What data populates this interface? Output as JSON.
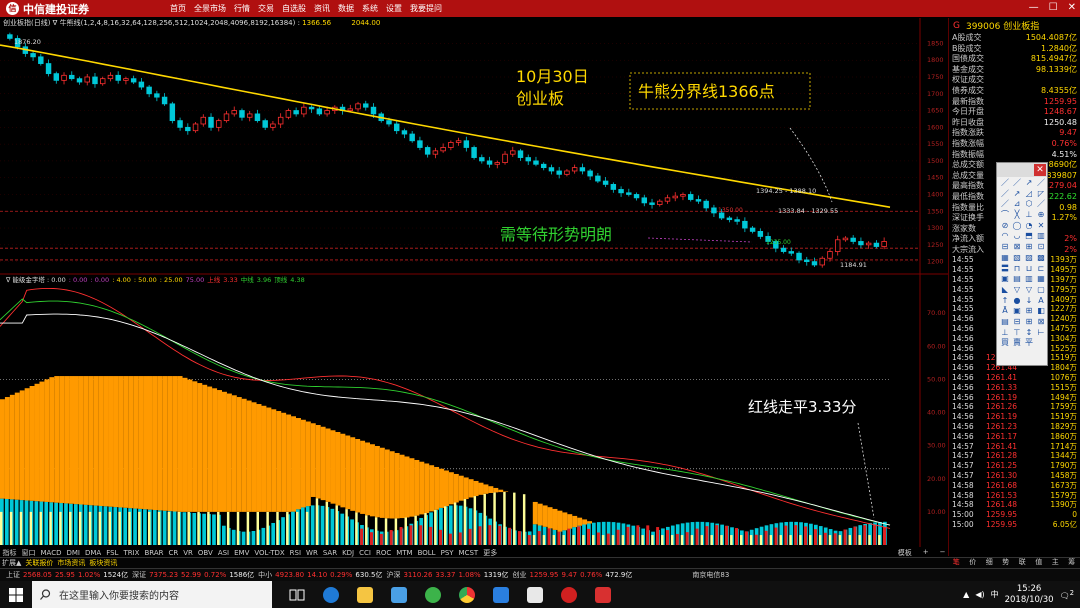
{
  "app": {
    "brand": "中信建投证券",
    "brand_badge": "信",
    "menu": [
      "首页",
      "全景市场",
      "行情",
      "交易",
      "自选股",
      "资讯",
      "数据",
      "系统",
      "设置",
      "我要提问"
    ],
    "window_controls": [
      "—",
      "☐",
      "✕"
    ]
  },
  "chart_header": {
    "prefix": "创业板指(日线) ∇ 牛熊线(1,2,4,8,16,32,64,128,256,512,1024,2048,4096,8192,16384) :",
    "ma_value": "1366.56",
    "extra": "2044.00"
  },
  "price_axis_labels": [
    "1850",
    "1800",
    "1750",
    "1700",
    "1650",
    "1600",
    "1550",
    "1500",
    "1450",
    "1400",
    "1350",
    "1300",
    "1250",
    "1200"
  ],
  "osc_axis_labels": [
    "70.00",
    "60.00",
    "50.00",
    "40.00",
    "30.00",
    "20.00",
    "10.00"
  ],
  "date_labels": [
    "2018/08",
    "9",
    "10"
  ],
  "annotations": {
    "date_title_1": "10月30日",
    "date_title_2": "创业板",
    "boundary_box": "牛熊分界线1366点",
    "wait_text": "需等待形势明朗",
    "red_line_text": "红线走平3.33分",
    "hi_label": "1876.20",
    "range_label_1": "1394.25 - 1388.10",
    "range_label_2": "1333.84 - 1329.55",
    "low_label": "1184.91",
    "mid_label_1": "1350.00",
    "mid_label_2": "1235.00"
  },
  "osc_header": {
    "name": "∇ 能级金字塔 : 0.00",
    "items": [
      ": 0.00",
      ": 0.00",
      ": 4.00",
      ": 50.00",
      ": 25.00"
    ],
    "v75": "75.00",
    "upper_label": "上线",
    "upper": "3.33",
    "mid_label": "中线",
    "mid": "3.96",
    "lower_label": "顶线",
    "lower": "4.38"
  },
  "right_panel": {
    "header_g": "G",
    "code": "399006 创业板指",
    "stats": [
      {
        "label": "A股成交",
        "value": "1504.4087亿",
        "color": "yellow"
      },
      {
        "label": "B股成交",
        "value": "1.2840亿",
        "color": "yellow"
      },
      {
        "label": "国债成交",
        "value": "815.4947亿",
        "color": "yellow"
      },
      {
        "label": "基金成交",
        "value": "98.1339亿",
        "color": "yellow"
      },
      {
        "label": "权证成交",
        "value": "",
        "color": "yellow"
      },
      {
        "label": "债券成交",
        "value": "8.4355亿",
        "color": "yellow"
      },
      {
        "label": "最新指数",
        "value": "1259.95",
        "color": "red"
      },
      {
        "label": "今日开盘",
        "value": "1248.67",
        "color": "red"
      },
      {
        "label": "昨日收盘",
        "value": "1250.48",
        "color": "white"
      },
      {
        "label": "指数涨跌",
        "value": "9.47",
        "color": "red"
      },
      {
        "label": "指数涨幅",
        "value": "0.76%",
        "color": "red"
      },
      {
        "label": "指数振幅",
        "value": "4.51%",
        "color": "white"
      },
      {
        "label": "总成交额",
        "value": "8690亿",
        "color": "yellow"
      },
      {
        "label": "总成交量",
        "value": "339807",
        "color": "yellow"
      },
      {
        "label": "最高指数",
        "value": "1279.04",
        "color": "red"
      },
      {
        "label": "最低指数",
        "value": "1222.62",
        "color": "green"
      },
      {
        "label": "指数量比",
        "value": "0.98",
        "color": "yellow"
      },
      {
        "label": "深证换手",
        "value": "1.27%",
        "color": "yellow"
      },
      {
        "label": "涨家数",
        "value": "",
        "color": "red"
      },
      {
        "label": "净流入额",
        "value": "2%",
        "color": "red"
      },
      {
        "label": "大宗流入",
        "value": "2%",
        "color": "red"
      }
    ],
    "ticks": [
      {
        "t": "14:55",
        "p": "",
        "v": "1393万"
      },
      {
        "t": "14:55",
        "p": "",
        "v": "1495万"
      },
      {
        "t": "14:55",
        "p": "",
        "v": "1397万"
      },
      {
        "t": "14:55",
        "p": "",
        "v": "1795万"
      },
      {
        "t": "14:55",
        "p": "",
        "v": "1409万"
      },
      {
        "t": "14:55",
        "p": "",
        "v": "1227万"
      },
      {
        "t": "14:56",
        "p": "",
        "v": "1240万"
      },
      {
        "t": "14:56",
        "p": "",
        "v": "1475万"
      },
      {
        "t": "14:56",
        "p": "",
        "v": "1304万"
      },
      {
        "t": "14:56",
        "p": "",
        "v": "1525万"
      },
      {
        "t": "14:56",
        "p": "1261.29",
        "v": "1519万"
      },
      {
        "t": "14:56",
        "p": "1261.44",
        "v": "1804万"
      },
      {
        "t": "14:56",
        "p": "1261.41",
        "v": "1076万"
      },
      {
        "t": "14:56",
        "p": "1261.33",
        "v": "1515万"
      },
      {
        "t": "14:56",
        "p": "1261.19",
        "v": "1494万"
      },
      {
        "t": "14:56",
        "p": "1261.26",
        "v": "1759万"
      },
      {
        "t": "14:56",
        "p": "1261.19",
        "v": "1519万"
      },
      {
        "t": "14:56",
        "p": "1261.23",
        "v": "1829万"
      },
      {
        "t": "14:56",
        "p": "1261.17",
        "v": "1860万"
      },
      {
        "t": "14:57",
        "p": "1261.41",
        "v": "1714万"
      },
      {
        "t": "14:57",
        "p": "1261.28",
        "v": "1344万"
      },
      {
        "t": "14:57",
        "p": "1261.25",
        "v": "1790万"
      },
      {
        "t": "14:57",
        "p": "1261.30",
        "v": "1458万"
      },
      {
        "t": "14:58",
        "p": "1261.68",
        "v": "1673万"
      },
      {
        "t": "14:58",
        "p": "1261.53",
        "v": "1579万"
      },
      {
        "t": "14:58",
        "p": "1261.48",
        "v": "1390万"
      },
      {
        "t": "15:00",
        "p": "1259.95",
        "v": "0"
      },
      {
        "t": "15:00",
        "p": "1259.95",
        "v": "6.05亿"
      }
    ]
  },
  "draw_tools": [
    "／",
    "／",
    "↗",
    "／",
    "／",
    "↗",
    "◿",
    "◸",
    "／",
    "⊿",
    "⬡",
    "／",
    "⌒",
    "╳",
    "⊥",
    "⊕",
    "⊘",
    "◯",
    "◔",
    "✕",
    "◠",
    "◡",
    "⬒",
    "▥",
    "⊟",
    "⊠",
    "⊞",
    "⊡",
    "▦",
    "▧",
    "▨",
    "▩",
    "〓",
    "⊓",
    "⊔",
    "⊏",
    "▣",
    "▤",
    "▥",
    "▦",
    "◣",
    "▽",
    "▽",
    "▢",
    "↑",
    "●",
    "↓",
    "A",
    "Ā",
    "▣",
    "⊞",
    "◧",
    "▤",
    "⊟",
    "⊞",
    "⊠",
    "⊥",
    "⊤",
    "↕",
    "⊢",
    "買",
    "賣",
    "平",
    ""
  ],
  "indicator_tabs": [
    "指标",
    "窗口",
    "MACD",
    "DMI",
    "DMA",
    "FSL",
    "TRIX",
    "BRAR",
    "CR",
    "VR",
    "OBV",
    "ASI",
    "EMV",
    "VOL-TDX",
    "RSI",
    "WR",
    "SAR",
    "KDJ",
    "CCI",
    "ROC",
    "MTM",
    "BOLL",
    "PSY",
    "MCST",
    "更多"
  ],
  "indicator_tabs_right": [
    "模板",
    "+",
    "−"
  ],
  "row2": {
    "exp": "扩展▲",
    "items": [
      "关联报价",
      "市场资讯",
      "板块资讯"
    ]
  },
  "rp_tabs": [
    "笔",
    "价",
    "细",
    "势",
    "联",
    "值",
    "主",
    "筹"
  ],
  "status_bar": [
    {
      "label": "上证",
      "price": "2568.05",
      "chg": "25.95",
      "pct": "1.02%",
      "vol": "1524亿"
    },
    {
      "label": "深证",
      "price": "7375.23",
      "chg": "52.99",
      "pct": "0.72%",
      "vol": "1586亿"
    },
    {
      "label": "中小",
      "price": "4923.80",
      "chg": "14.10",
      "pct": "0.29%",
      "vol": "630.5亿"
    },
    {
      "label": "沪深",
      "price": "3110.26",
      "chg": "33.37",
      "pct": "1.08%",
      "vol": "1319亿"
    },
    {
      "label": "创业",
      "price": "1259.95",
      "chg": "9.47",
      "pct": "0.76%",
      "vol": "472.9亿"
    }
  ],
  "status_tail": "南京电信83",
  "taskbar": {
    "search_placeholder": "在这里输入你要搜索的内容",
    "time": "15:26",
    "date": "2018/10/30",
    "notif": "2",
    "lang": "中"
  },
  "colors": {
    "up": "#ff3030",
    "down": "#00c8d8",
    "ma": "#ffd800",
    "orange": "#ff9a00",
    "cyan": "#00c8d8",
    "pale": "#ffff99"
  }
}
